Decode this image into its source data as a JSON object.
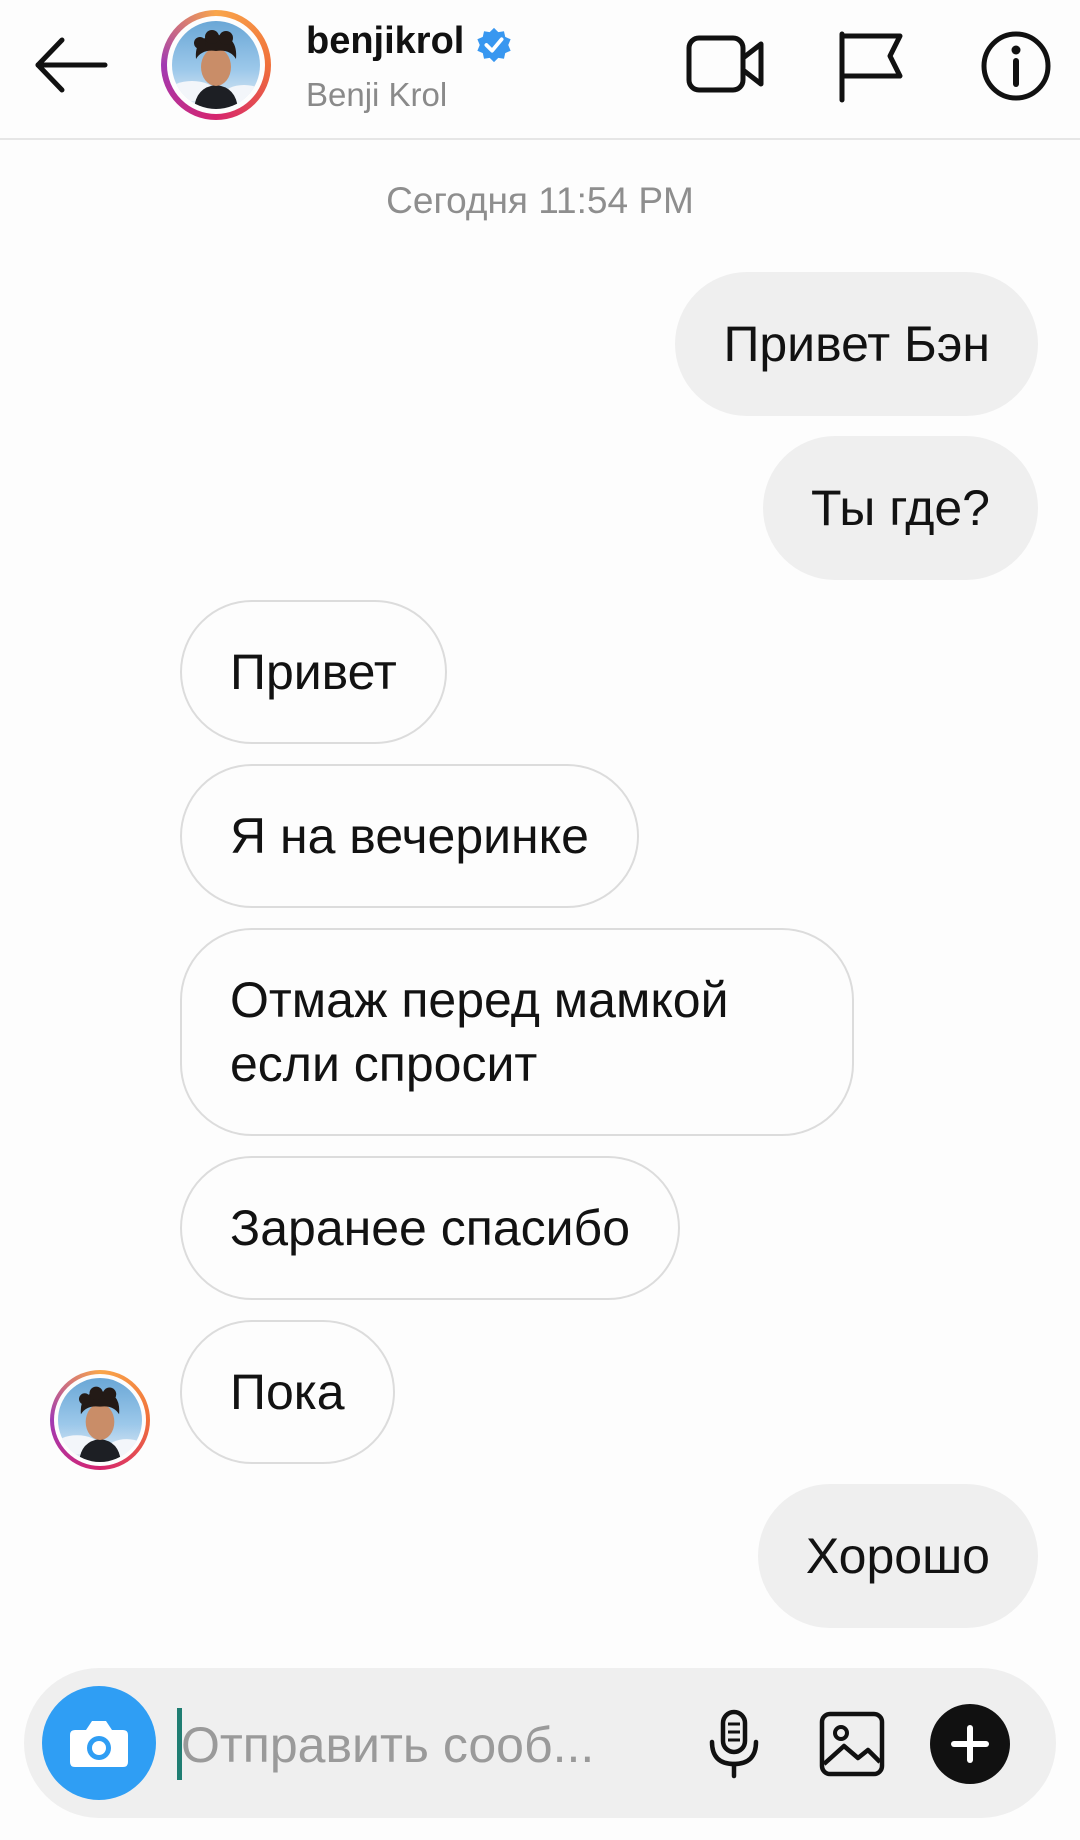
{
  "header": {
    "username": "benjikrol",
    "full_name": "Benji Krol",
    "icons": [
      "back-arrow-icon",
      "verified-badge-icon",
      "video-call-icon",
      "flag-icon",
      "info-icon"
    ]
  },
  "thread": {
    "timestamp": "Сегодня 11:54 PM",
    "messages": [
      {
        "from": "me",
        "text": "Привет Бэн"
      },
      {
        "from": "me",
        "text": "Ты где?"
      },
      {
        "from": "them",
        "text": "Привет"
      },
      {
        "from": "them",
        "text": "Я на вечеринке"
      },
      {
        "from": "them",
        "text": "Отмаж перед мамкой если спросит"
      },
      {
        "from": "them",
        "text": "Заранее спасибо"
      },
      {
        "from": "them",
        "text": "Пока"
      },
      {
        "from": "me",
        "text": "Хорошо"
      }
    ]
  },
  "composer": {
    "placeholder": "Отправить сооб...",
    "value": "",
    "icons": [
      "camera-icon",
      "microphone-icon",
      "gallery-icon",
      "plus-icon"
    ]
  },
  "colors": {
    "accent_blue": "#2f9ef4",
    "sent_bubble": "#efefef",
    "received_border": "#dcdcdc",
    "verified_blue": "#3897f0"
  }
}
